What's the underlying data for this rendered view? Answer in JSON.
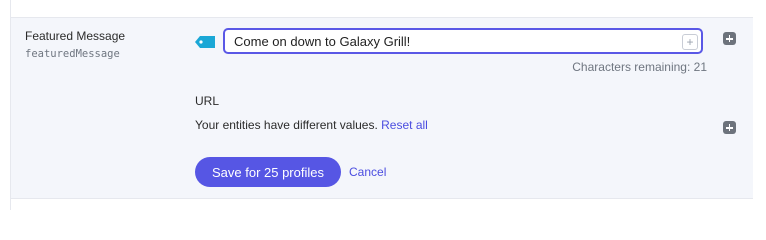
{
  "field": {
    "label": "Featured Message",
    "key": "featuredMessage",
    "value": "Come on down to Galaxy Grill!",
    "characters_remaining": "Characters remaining: 21",
    "tag_color": "#1aa7d6"
  },
  "url": {
    "label": "URL",
    "different_values_text": "Your entities have different values.",
    "reset_label": "Reset all"
  },
  "actions": {
    "save_label": "Save for 25 profiles",
    "cancel_label": "Cancel"
  },
  "icons": {
    "input_add": "+",
    "accent": "#5656e4"
  }
}
